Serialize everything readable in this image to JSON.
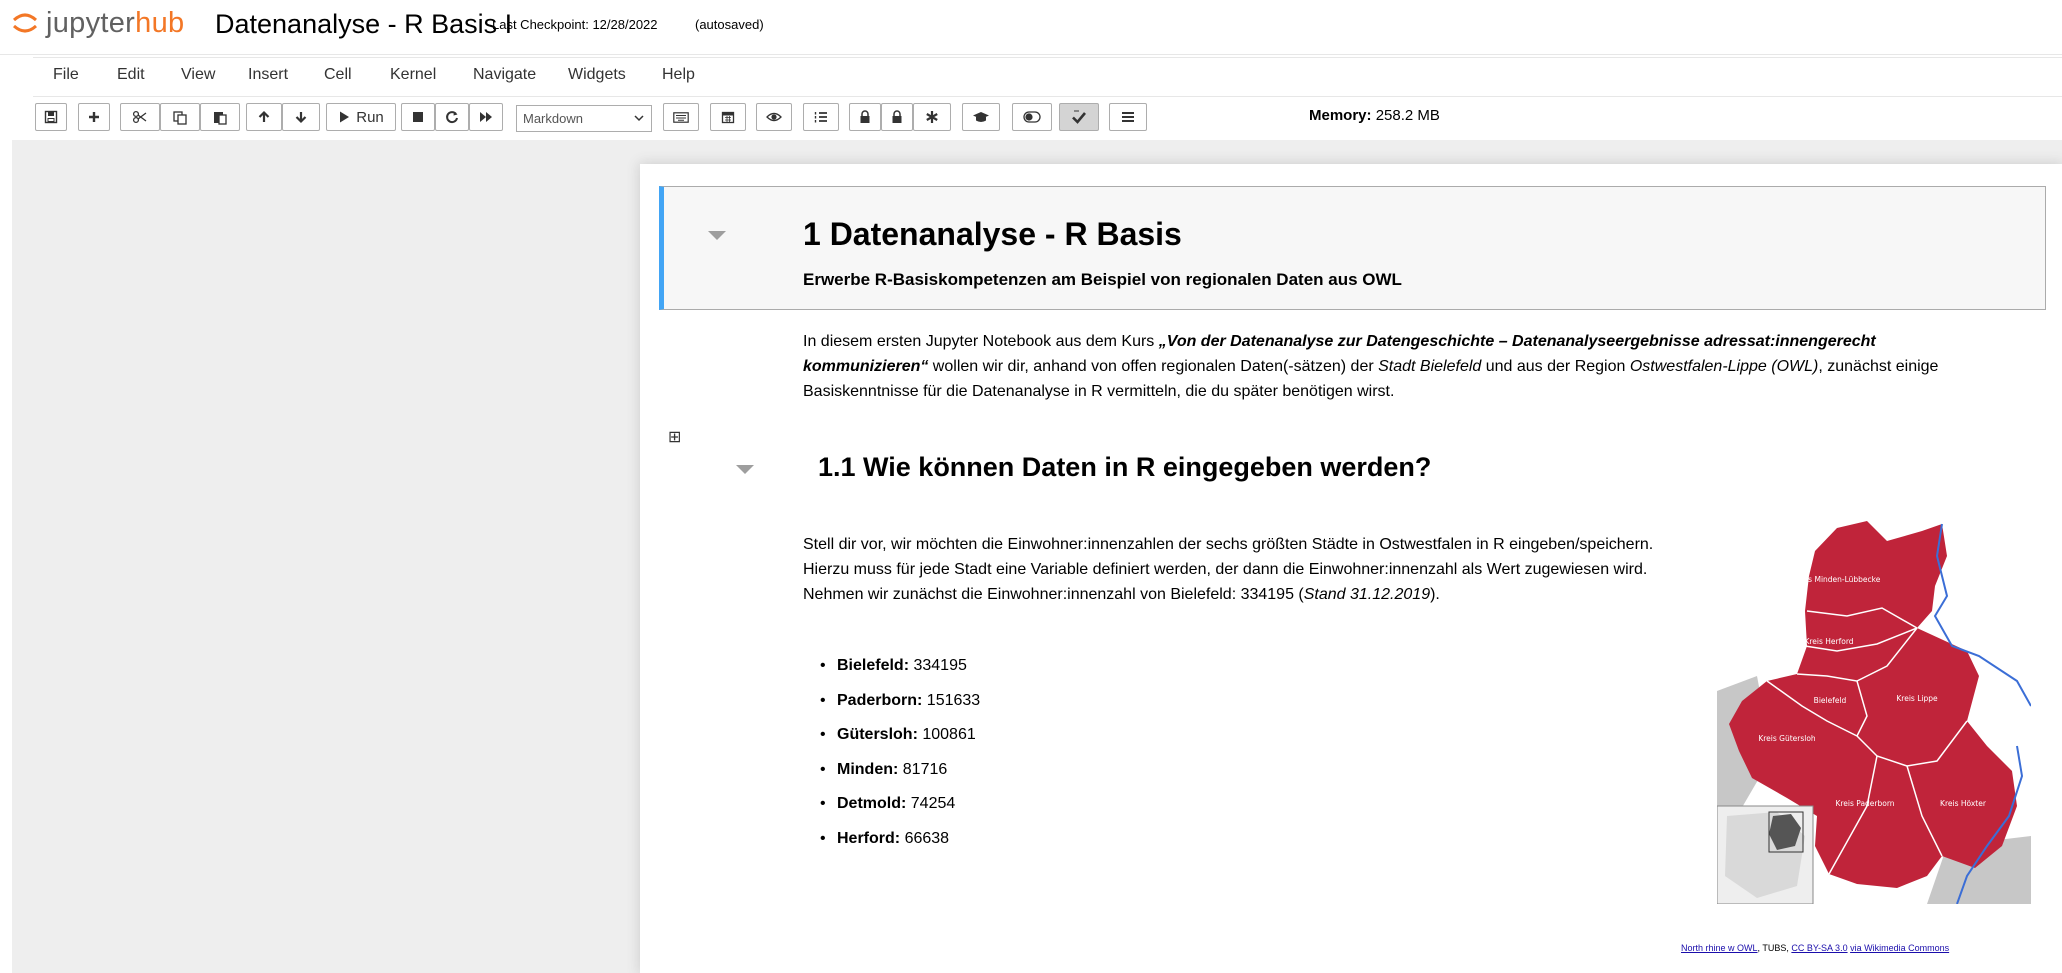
{
  "header": {
    "logo": {
      "jupyter": "jupyter",
      "hub": "hub"
    },
    "notebook_title": "Datenanalyse - R Basis",
    "title_cursor": "I",
    "checkpoint": "Last Checkpoint: 12/28/2022",
    "autosaved": "(autosaved)"
  },
  "menu": {
    "items": [
      "File",
      "Edit",
      "View",
      "Insert",
      "Cell",
      "Kernel",
      "Navigate",
      "Widgets",
      "Help"
    ]
  },
  "toolbar": {
    "run_label": "Run",
    "cell_type": "Markdown",
    "memory_label": "Memory:",
    "memory_value": "258.2 MB",
    "icons": [
      "save-icon",
      "plus-icon",
      "cut-icon",
      "copy-icon",
      "paste-icon",
      "arrow-up-icon",
      "arrow-down-icon",
      "play-icon",
      "stop-icon",
      "restart-icon",
      "fast-forward-icon",
      "keyboard-icon",
      "calendar-icon",
      "eye-icon",
      "numbered-list-icon",
      "lock-icon",
      "lock-icon",
      "asterisk-icon",
      "graduation-cap-icon",
      "toggle-icon",
      "check-icon",
      "list-icon"
    ]
  },
  "notebook": {
    "h1": "1  Datenanalyse - R Basis",
    "h1_sub": "Erwerbe R-Basiskompetenzen am Beispiel von regionalen Daten aus OWL",
    "intro": {
      "p1": "In diesem ersten Jupyter Notebook aus dem Kurs ",
      "course": "„Von der Datenanalyse zur Datengeschichte – Datenanalyseergebnisse adressat:innengerecht kommunizieren“",
      "p2": " wollen wir dir, anhand von offen regionalen Daten(-sätzen) der ",
      "city": "Stadt Bielefeld",
      "p3": " und aus der Region ",
      "region": "Ostwestfalen-Lippe (OWL)",
      "p4": ", zunächst einige Basiskenntnisse für die Datenanalyse in R vermitteln, die du später benötigen wirst."
    },
    "h2": "1.1  Wie können Daten in R eingegeben werden?",
    "para": {
      "p1": "Stell dir vor, wir möchten die Einwohner:innenzahlen der sechs größten Städte in Ostwestfalen in R eingeben/speichern. Hierzu muss für jede Stadt eine Variable definiert werden, der dann die Einwohner:innenzahl als Wert zugewiesen wird. Nehmen wir zunächst die Einwohner:innenzahl von Bielefeld: 334195 (",
      "stand": "Stand 31.12.2019",
      "p2": ")."
    },
    "cities": [
      {
        "name": "Bielefeld:",
        "value": "334195"
      },
      {
        "name": "Paderborn:",
        "value": "151633"
      },
      {
        "name": "Gütersloh:",
        "value": "100861"
      },
      {
        "name": "Minden:",
        "value": "81716"
      },
      {
        "name": "Detmold:",
        "value": "74254"
      },
      {
        "name": "Herford:",
        "value": "66638"
      }
    ],
    "map": {
      "labels": [
        "Kreis Minden-Lübbecke",
        "Kreis Herford",
        "Bielefeld",
        "Kreis Lippe",
        "Kreis Gütersloh",
        "Kreis Paderborn",
        "Kreis Höxter"
      ],
      "region_color": "#c0243a"
    },
    "credit": {
      "link1": "North rhine w OWL",
      "author": ", TUBS, ",
      "link2": "CC BY-SA 3.0",
      "link3": "via Wikimedia Commons"
    }
  }
}
